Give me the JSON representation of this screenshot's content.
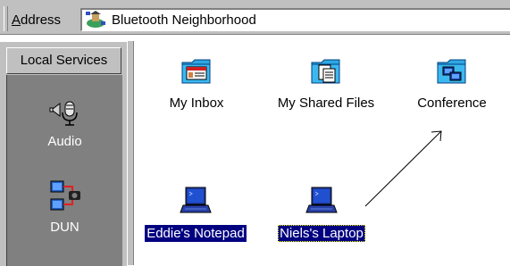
{
  "address_bar": {
    "label_accel": "A",
    "label_rest": "ddress",
    "value": "Bluetooth Neighborhood",
    "icon": "bluetooth-neighborhood-icon"
  },
  "left_pane": {
    "header": "Local Services",
    "services": [
      {
        "label": "Audio",
        "icon": "headset-audio-icon"
      },
      {
        "label": "DUN",
        "icon": "dialup-network-icon"
      }
    ]
  },
  "folders": [
    {
      "label": "My Inbox",
      "icon": "business-card-folder-icon"
    },
    {
      "label": "My Shared Files",
      "icon": "shared-files-folder-icon"
    },
    {
      "label": "Conference",
      "icon": "conference-folder-icon"
    }
  ],
  "devices": [
    {
      "label": "Eddie's Notepad",
      "icon": "laptop-icon",
      "selected": true
    },
    {
      "label": "Niels's Laptop",
      "icon": "laptop-icon",
      "selected": true,
      "focused": true
    }
  ],
  "colors": {
    "chrome": "#c0c0c0",
    "panel_dark": "#808080",
    "selection": "#000080",
    "folder_blue": "#2fa8e0"
  }
}
